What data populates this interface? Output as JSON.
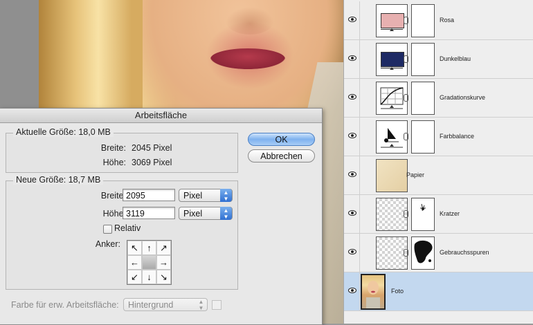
{
  "dialog": {
    "title": "Arbeitsfläche",
    "current": {
      "legend": "Aktuelle Größe: 18,0 MB",
      "width_label": "Breite:",
      "width_value": "2045 Pixel",
      "height_label": "Höhe:",
      "height_value": "3069 Pixel"
    },
    "new": {
      "legend": "Neue Größe: 18,7 MB",
      "width_label": "Breite:",
      "width_value": "2095",
      "height_label": "Höhe:",
      "height_value": "3119",
      "unit": "Pixel",
      "relative_label": "Relativ",
      "anchor_label": "Anker:"
    },
    "ok_label": "OK",
    "cancel_label": "Abbrechen",
    "extension_color_label": "Farbe für erw. Arbeitsfläche:",
    "extension_color_value": "Hintergrund",
    "anchor_arrows": [
      "↖",
      "↑",
      "↗",
      "←",
      "",
      "→",
      "↙",
      "↓",
      "↘"
    ]
  },
  "layers": [
    {
      "name": "Rosa",
      "swatch": "#e7b0b0"
    },
    {
      "name": "Dunkelblau",
      "swatch": "#1e2a64"
    },
    {
      "name": "Gradationskurve"
    },
    {
      "name": "Farbbalance"
    },
    {
      "name": "Papier"
    },
    {
      "name": "Kratzer"
    },
    {
      "name": "Gebrauchsspuren"
    },
    {
      "name": "Foto"
    }
  ],
  "colors": {
    "selected_layer": "#c3d8ef",
    "ok_button": "#7fb2ef",
    "paper": "#efe0bf"
  }
}
